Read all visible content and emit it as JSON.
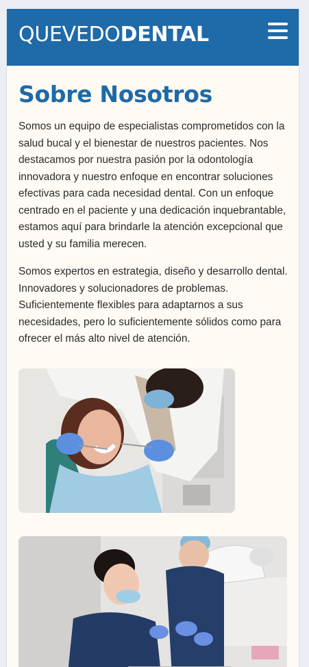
{
  "header": {
    "logo_light": "QUEVEDO",
    "logo_bold": "DENTAL",
    "menu_icon": "hamburger-menu-icon",
    "bg_color": "#1f6aa8"
  },
  "about": {
    "title": "Sobre Nosotros",
    "paragraph_1": "Somos un equipo de especialistas comprometidos con la salud bucal y el bienestar de nuestros pacientes. Nos destacamos por nuestra pasión por la odontología innovadora y nuestro enfoque en encontrar soluciones efectivas para cada necesidad dental. Con un enfoque centrado en el paciente y una dedicación inquebrantable, estamos aquí para brindarle la atención excepcional que usted y su familia merecen.",
    "paragraph_2": "Somos expertos en estrategia, diseño y desarrollo dental. Innovadores y solucionadores de problemas. Suficientemente flexibles para adaptarnos a sus necesidades, pero lo suficientemente sólidos como para ofrecer el más alto nivel de atención."
  },
  "colors": {
    "accent": "#1d6aa7",
    "page_bg": "#fffaf3"
  }
}
